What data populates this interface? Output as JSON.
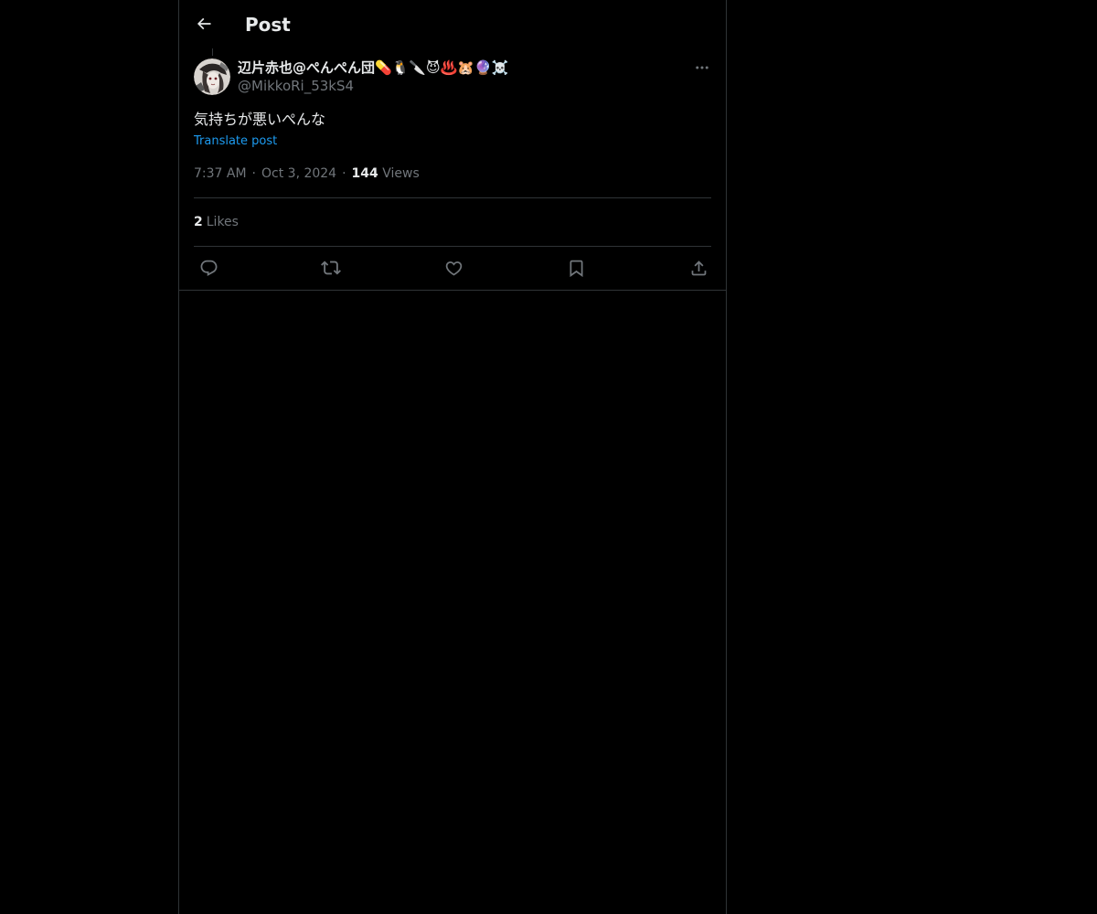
{
  "header": {
    "title": "Post",
    "back_icon": "arrow-left-icon"
  },
  "author": {
    "display_name": "辺片赤也@ぺんぺん団💊🐧🔪😈♨️🐹🔮☠️",
    "handle": "@MikkoRi_53kS4",
    "avatar_icon": "avatar-image"
  },
  "post": {
    "text": "気持ちが悪いぺんな",
    "translate_label": "Translate post",
    "time": "7:37 AM",
    "date": "Oct 3, 2024",
    "views_count": "144",
    "views_label": "Views",
    "dot": "·"
  },
  "stats": {
    "likes_count": "2",
    "likes_label": "Likes"
  },
  "actions": {
    "reply_icon": "reply-icon",
    "repost_icon": "repost-icon",
    "like_icon": "heart-icon",
    "bookmark_icon": "bookmark-icon",
    "share_icon": "share-icon"
  },
  "colors": {
    "background": "#000000",
    "text": "#e7e9ea",
    "muted": "#71767b",
    "link": "#1d9bf0",
    "border": "#2f3336"
  }
}
